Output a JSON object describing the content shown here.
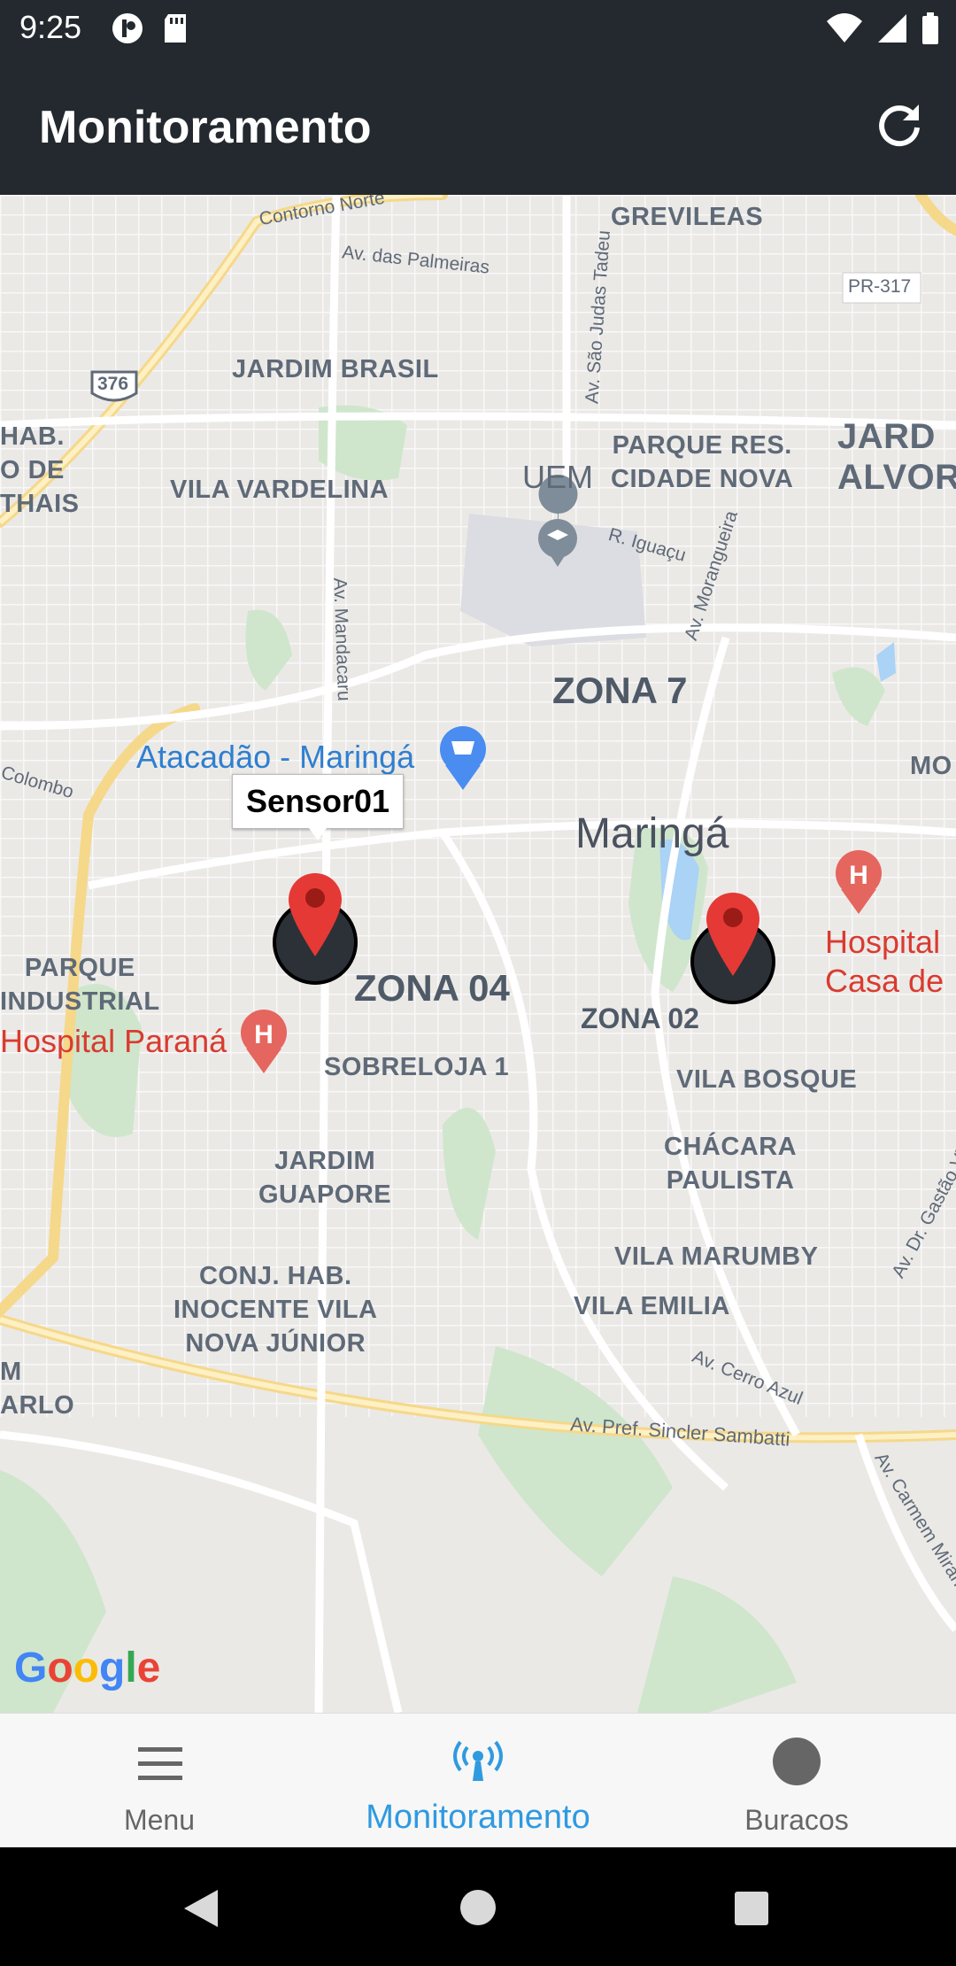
{
  "status_bar": {
    "time": "9:25"
  },
  "app_bar": {
    "title": "Monitoramento",
    "refresh_icon": "refresh-icon"
  },
  "map": {
    "neighborhoods": [
      "GREVILEAS",
      "JARDIM BRASIL",
      "PARQUE RES.\nCIDADE NOVA",
      "JARD\nALVOR",
      "HAB.\nO DE\nTHAIS",
      "VILA VARDELINA",
      "PARQUE\nINDUSTRIAL",
      "SOBRELOJA 1",
      "VILA BOSQUE",
      "CHÁCARA\nPAULISTA",
      "JARDIM\nGUAPORE",
      "VILA MARUMBY",
      "CONJ. HAB.\nINOCENTE VILA\nNOVA JÚNIOR",
      "VILA EMILIA",
      "M\nARLO",
      "MO"
    ],
    "zones": [
      "ZONA 7",
      "ZONA 04",
      "ZONA 02"
    ],
    "city": "Maringá",
    "uem": "UEM",
    "streets": [
      "Contorno Norte",
      "Av. das Palmeiras",
      "Av. São Judas Tadeu",
      "R. Iguaçu",
      "Av. Morangueira",
      "Av. Mandacaru",
      "Colombo",
      "Av. Cerro Azul",
      "Av. Pref. Sincler Sambatti",
      "Av. Dr. Gastão Vidigal",
      "Av. Carmem Miran",
      "PR-317",
      "376"
    ],
    "places": {
      "atacadao": "Atacadão - Maringá",
      "hospital_parana": "Hospital Paraná",
      "hospital_casa": "Hospital\nCasa de"
    },
    "google": "Google",
    "markers": [
      {
        "id": "sensor01",
        "tooltip": "Sensor01"
      },
      {
        "id": "sensor02"
      }
    ]
  },
  "bottom_nav": {
    "items": [
      {
        "label": "Menu",
        "icon": "menu-icon",
        "active": false
      },
      {
        "label": "Monitoramento",
        "icon": "antenna-icon",
        "active": true
      },
      {
        "label": "Buracos",
        "icon": "circle-icon",
        "active": false
      }
    ]
  },
  "colors": {
    "app_bar": "#23292e",
    "active": "#2f9ae0",
    "marker": "#e53935"
  }
}
